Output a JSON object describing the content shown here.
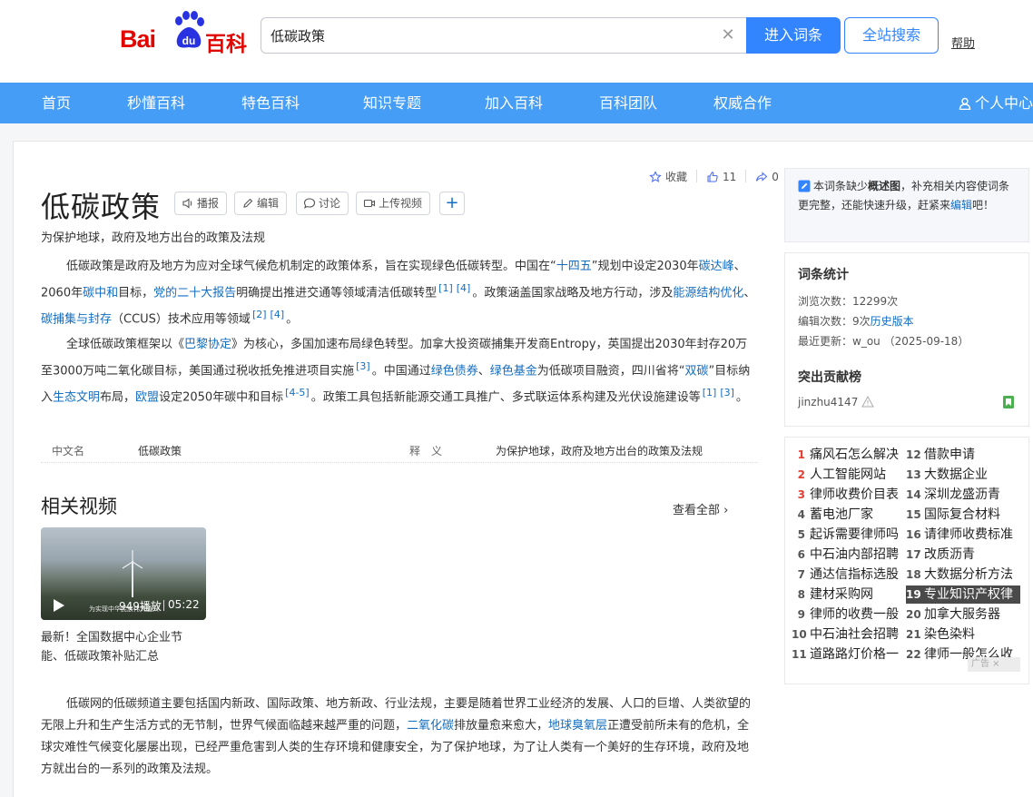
{
  "header": {
    "logo_bai": "Bai",
    "logo_du": "du",
    "logo_baike": "百科",
    "search_value": "低碳政策",
    "enter_label": "进入词条",
    "site_search_label": "全站搜索",
    "help_label": "帮助"
  },
  "nav": {
    "items": [
      "首页",
      "秒懂百科",
      "特色百科",
      "知识专题",
      "加入百科",
      "百科团队",
      "权威合作"
    ],
    "user": "个人中心"
  },
  "article": {
    "title": "低碳政策",
    "tools": [
      "播报",
      "编辑",
      "讨论",
      "上传视频"
    ],
    "actions": {
      "collect": "收藏",
      "likes": "11",
      "shares": "0"
    },
    "subtitle": "为保护地球，政府及地方出台的政策及法规",
    "para1": [
      {
        "t": "低碳政策是政府及地方为应对全球气候危机制定的政策体系，旨在实现绿色低碳转型。中国在“"
      },
      {
        "t": "十四五",
        "link": true
      },
      {
        "t": "”规划中设定2030年"
      },
      {
        "t": "碳达峰",
        "link": true
      },
      {
        "t": "、2060年"
      },
      {
        "t": "碳中和",
        "link": true
      },
      {
        "t": "目标，"
      },
      {
        "t": "党的二十大报告",
        "link": true
      },
      {
        "t": "明确提出推进交通等领域清洁低碳转型"
      },
      {
        "t": "[1]",
        "sup": true
      },
      {
        "t": "[4]",
        "sup": true
      },
      {
        "t": "。政策涵盖国家战略及地方行动，涉及"
      },
      {
        "t": "能源结构优化",
        "link": true
      },
      {
        "t": "、"
      },
      {
        "t": "碳捕集与封存",
        "link": true
      },
      {
        "t": "（CCUS）技术应用等领域"
      },
      {
        "t": "[2]",
        "sup": true
      },
      {
        "t": "[4]",
        "sup": true
      },
      {
        "t": "。"
      }
    ],
    "para2": [
      {
        "t": "全球低碳政策框架以《"
      },
      {
        "t": "巴黎协定",
        "link": true
      },
      {
        "t": "》为核心，多国加速布局绿色转型。加拿大投资碳捕集开发商Entropy，英国提出2030年封存20万至3000万吨二氧化碳目标，美国通过税收抵免推进项目实施"
      },
      {
        "t": "[3]",
        "sup": true
      },
      {
        "t": "。中国通过"
      },
      {
        "t": "绿色债券",
        "link": true
      },
      {
        "t": "、"
      },
      {
        "t": "绿色基金",
        "link": true
      },
      {
        "t": "为低碳项目融资，四川省将“"
      },
      {
        "t": "双碳",
        "link": true
      },
      {
        "t": "”目标纳入"
      },
      {
        "t": "生态文明",
        "link": true
      },
      {
        "t": "布局，"
      },
      {
        "t": "欧盟",
        "link": true
      },
      {
        "t": "设定2050年碳中和目标"
      },
      {
        "t": "[4-5]",
        "sup": true
      },
      {
        "t": "。政策工具包括新能源交通工具推广、多式联运体系构建及光伏设施建设等"
      },
      {
        "t": "[1]",
        "sup": true
      },
      {
        "t": "[3]",
        "sup": true
      },
      {
        "t": "。"
      }
    ],
    "infobox": {
      "k1": "中文名",
      "v1": "低碳政策",
      "k2": "释　义",
      "v2": "为保护地球，政府及地方出台的政策及法规"
    },
    "para3": [
      {
        "t": "低碳网的低碳频道主要包括国内新政、国际政策、地方新政、行业法规，主要是随着世界工业经济的发展、人口的巨增、人类欲望的无限上升和生产生活方式的无节制，世界气候面临越来越严重的问题，"
      },
      {
        "t": "二氧化碳",
        "link": true
      },
      {
        "t": "排放量愈来愈大，"
      },
      {
        "t": "地球臭氧层",
        "link": true
      },
      {
        "t": "正遭受前所未有的危机，全球灾难性气候变化屡屡出现，已经严重危害到人类的生存环境和健康安全，为了保护地球，为了让人类有一个美好的生存环境，政府及地方就出台的一系列的政策及法规。"
      }
    ]
  },
  "videos": {
    "title": "相关视频",
    "view_all": "查看全部",
    "plays": "949播放",
    "duration": "05:22",
    "watermark": "为实现中华民族伟大复兴",
    "caption": "最新！全国数据中心企业节能、低碳政策补贴汇总"
  },
  "notice": {
    "pre": "本词条缺少",
    "bold": "概述图",
    "mid": "，补充相关内容使词条更完整，还能快速升级，赶紧来",
    "link": "编辑",
    "post": "吧！"
  },
  "stats": {
    "title": "词条统计",
    "views": "浏览次数：12299次",
    "edits_pre": "编辑次数：9次",
    "edits_link": "历史版本",
    "updated": "最近更新：w_ou （2025-09-18）",
    "contrib_title": "突出贡献榜",
    "contributor": "jinzhu4147"
  },
  "hotlist": {
    "left": [
      {
        "n": "1",
        "t": "痛风石怎么解决"
      },
      {
        "n": "2",
        "t": "人工智能网站"
      },
      {
        "n": "3",
        "t": "律师收费价目表"
      },
      {
        "n": "4",
        "t": "蓄电池厂家"
      },
      {
        "n": "5",
        "t": "起诉需要律师吗"
      },
      {
        "n": "6",
        "t": "中石油内部招聘"
      },
      {
        "n": "7",
        "t": "通达信指标选股"
      },
      {
        "n": "8",
        "t": "建材采购网"
      },
      {
        "n": "9",
        "t": "律师的收费一般"
      },
      {
        "n": "10",
        "t": "中石油社会招聘"
      },
      {
        "n": "11",
        "t": "道路路灯价格一"
      }
    ],
    "right": [
      {
        "n": "12",
        "t": "借款申请"
      },
      {
        "n": "13",
        "t": "大数据企业"
      },
      {
        "n": "14",
        "t": "深圳龙盛沥青"
      },
      {
        "n": "15",
        "t": "国际复合材料"
      },
      {
        "n": "16",
        "t": "请律师收费标准"
      },
      {
        "n": "17",
        "t": "改质沥青"
      },
      {
        "n": "18",
        "t": "大数据分析方法"
      },
      {
        "n": "19",
        "t": "专业知识产权律"
      },
      {
        "n": "20",
        "t": "加拿大服务器"
      },
      {
        "n": "21",
        "t": "染色染料"
      },
      {
        "n": "22",
        "t": "律师一般怎么收"
      }
    ],
    "ad_tag": "广告 ×"
  }
}
